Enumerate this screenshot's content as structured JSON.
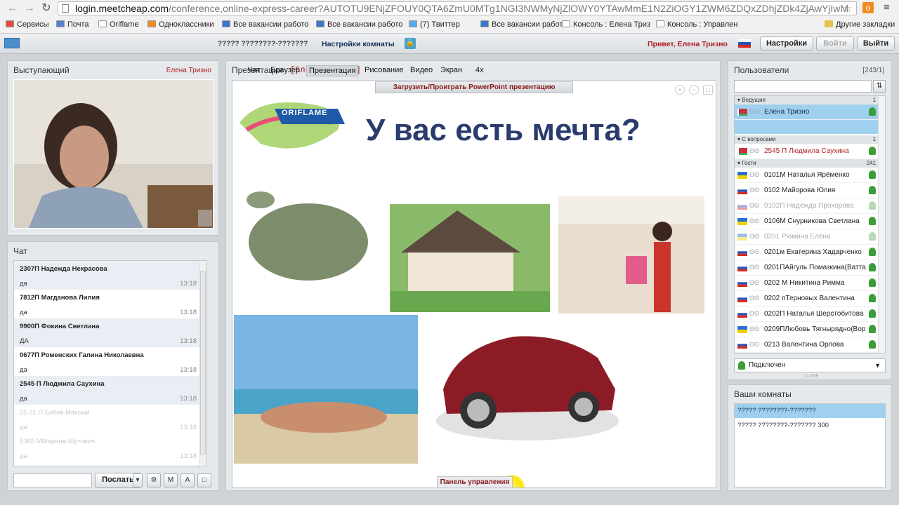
{
  "browser": {
    "url_host": "login.meetcheap.com",
    "url_rest": "/conference,online-express-career?AUTOTU9ENjZFOUY0QTA6ZmU0MTg1NGI3NWMyNjZlOWY0YTAwMmE1N2ZiOGY1ZWM6ZDQxZDhjZDk4ZjAwYjIwM",
    "bookmarks": [
      {
        "label": "Сервисы",
        "icon": "apps-icon",
        "color": "#e24d3c"
      },
      {
        "label": "Почта",
        "icon": "mail-icon",
        "color": "#5b7fc8"
      },
      {
        "label": "Oriflame",
        "icon": "oriflame-icon",
        "color": "#ffffff"
      },
      {
        "label": "Одноклассники",
        "icon": "ok-icon",
        "color": "#f28b22"
      },
      {
        "label": "Все вакансии работо",
        "icon": "folder-icon",
        "color": "#3c78c8"
      },
      {
        "label": "Все вакансии работо",
        "icon": "folder-icon",
        "color": "#3c78c8"
      },
      {
        "label": "(7) Твиттер",
        "icon": "twitter-icon",
        "color": "#55acee"
      },
      {
        "label": "Все вакансии работо",
        "icon": "folder-icon",
        "color": "#3c78c8"
      },
      {
        "label": "Консоль : Елена Триз",
        "icon": "page-icon",
        "color": "#ffffff"
      },
      {
        "label": "Консоль : Управлен",
        "icon": "page-icon",
        "color": "#ffffff"
      }
    ],
    "other_bookmarks": "Другие закладки"
  },
  "toolbar": {
    "room_name": "????? ????????-???????",
    "room_settings": "Настройки комнаты",
    "greeting": "Привет, Елена Тризно",
    "settings_btn": "Настройки",
    "login_btn": "Войти",
    "logout_btn": "Выйти"
  },
  "speaker": {
    "title": "Выступающий",
    "name": "Елена Тризно"
  },
  "chat": {
    "title": "Чат",
    "messages": [
      {
        "who": "2307П Надежда Некрасова",
        "text": "да",
        "time": "13:18"
      },
      {
        "who": "7812П Магданова Лилия",
        "text": "да",
        "time": "13:18"
      },
      {
        "who": "9900П Фокина Светлана",
        "text": "ДА",
        "time": "13:18"
      },
      {
        "who": "0677П Роменских Галина Николаевна",
        "text": "да",
        "time": "13:18"
      },
      {
        "who": "2545 П Людмила  Саухина",
        "text": "да",
        "time": "13:18"
      },
      {
        "who": "25 01 П Бибик Максим",
        "text": "да",
        "time": "13:18"
      },
      {
        "who": "5388 ММарина Шутович",
        "text": "да",
        "time": "13:18"
      }
    ],
    "send_label": "Послать"
  },
  "presentation": {
    "title": "Презентация",
    "presenter": "[Елена Тризно]",
    "tabs": [
      "Чат",
      "Браузер",
      "Презентация",
      "Рисование",
      "Видео",
      "Экран",
      "4x"
    ],
    "active_tab": 2,
    "upload_label": "Загрузить/Проиграть PowerPoint презентацию",
    "slide_title": "У вас есть мечта?",
    "slide_brand": "ORIFLAME",
    "control_panel": "Панель управления"
  },
  "users": {
    "title": "Пользователи",
    "count": "[243/1]",
    "groups": [
      {
        "label": "Ведущие",
        "count": "1"
      },
      {
        "label": "С вопросами",
        "count": "1"
      },
      {
        "label": "Гости",
        "count": "241"
      }
    ],
    "hosts": [
      {
        "name": "Елена Тризно",
        "flag": "by",
        "selected": true
      }
    ],
    "questions": [
      {
        "name": "2545 П Людмила  Саухина",
        "flag": "by"
      }
    ],
    "guests": [
      {
        "name": "0101М Наталья Ярёменко",
        "flag": "ua",
        "faded": false
      },
      {
        "name": "0102 Майорова Юлия",
        "flag": "ru",
        "faded": false
      },
      {
        "name": "0102П Надежда Прохорова",
        "flag": "ru",
        "faded": true
      },
      {
        "name": "0106М Снурникова Светлана",
        "flag": "ua",
        "faded": false
      },
      {
        "name": "0201 Рюмина Елена",
        "flag": "ua",
        "faded": true
      },
      {
        "name": "0201м Екатерина Хадарченко",
        "flag": "ru",
        "faded": false
      },
      {
        "name": "0201ПАйгуль Помазкина(Ватта",
        "flag": "ru",
        "faded": false
      },
      {
        "name": "0202 М Никитина Римма",
        "flag": "ru",
        "faded": false
      },
      {
        "name": "0202 пТерновых Валентина",
        "flag": "ru",
        "faded": false
      },
      {
        "name": "0202П Наталья Шерстобитова",
        "flag": "ru",
        "faded": false
      },
      {
        "name": "0209ПЛюбовь Тягнырядно(Вор",
        "flag": "ua",
        "faded": false
      },
      {
        "name": "0213 Валентина Орлова",
        "flag": "ru",
        "faded": false
      }
    ],
    "status": "Подключен",
    "close_label": "CLOSE"
  },
  "rooms": {
    "title": "Ваши комнаты",
    "items": [
      {
        "label": "????? ????????-???????",
        "selected": true
      },
      {
        "label": "????? ????????-??????? 300",
        "selected": false
      }
    ]
  },
  "colors": {
    "accent_red": "#b01e1e",
    "navy": "#14305a",
    "selection": "#9fd0ee"
  }
}
